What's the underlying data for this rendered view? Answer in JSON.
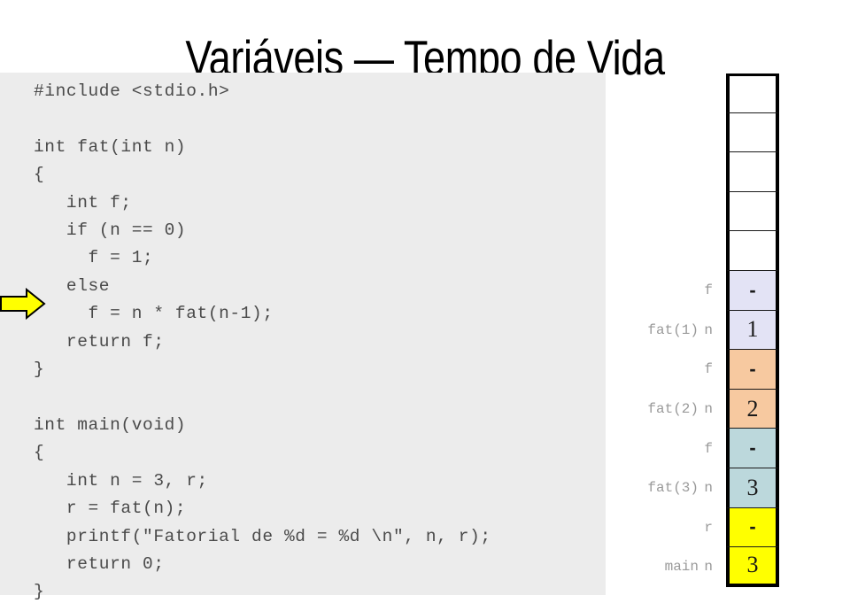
{
  "slide": {
    "title": "Variáveis — Tempo de Vida",
    "background_color": "#ffffff"
  },
  "code_panel": {
    "background_color": "#ececec",
    "text_color": "#4a4a4a",
    "language": "c",
    "listing": "#include <stdio.h>\n\nint fat(int n)\n{\n   int f;\n   if (n == 0)\n     f = 1;\n   else\n     f = n * fat(n-1);\n   return f;\n}\n\nint main(void)\n{\n   int n = 3, r;\n   r = fat(n);\n   printf(\"Fatorial de %d = %d \\n\", n, r);\n   return 0;\n}",
    "lines": [
      "#include <stdio.h>",
      "",
      "int fat(int n)",
      "{",
      "   int f;",
      "   if (n == 0)",
      "     f = 1;",
      "   else",
      "     f = n * fat(n-1);",
      "   return f;",
      "}",
      "",
      "int main(void)",
      "{",
      "   int n = 3, r;",
      "   r = fat(n);",
      "   printf(\"Fatorial de %d = %d \\n\", n, r);",
      "   return 0;",
      "}"
    ]
  },
  "step_arrow": {
    "icon": "arrow-right-icon",
    "fill_color": "#ffff00",
    "outline_color": "#000000",
    "points_to_line": "f = n * fat(n-1);",
    "points_to_line_index": 8
  },
  "stack_diagram": {
    "label_color": "#9a9a9a",
    "border_color": "#000000",
    "rows": [
      {
        "frame": "",
        "var": "",
        "value": "",
        "fill": "#ffffff"
      },
      {
        "frame": "",
        "var": "",
        "value": "",
        "fill": "#ffffff"
      },
      {
        "frame": "",
        "var": "",
        "value": "",
        "fill": "#ffffff"
      },
      {
        "frame": "",
        "var": "",
        "value": "",
        "fill": "#ffffff"
      },
      {
        "frame": "",
        "var": "",
        "value": "",
        "fill": "#ffffff"
      },
      {
        "frame": "",
        "var": "f",
        "value": "-",
        "fill": "#e3e3f5"
      },
      {
        "frame": "fat(1)",
        "var": "n",
        "value": "1",
        "fill": "#e3e3f5"
      },
      {
        "frame": "",
        "var": "f",
        "value": "-",
        "fill": "#f7c9a0"
      },
      {
        "frame": "fat(2)",
        "var": "n",
        "value": "2",
        "fill": "#f7c9a0"
      },
      {
        "frame": "",
        "var": "f",
        "value": "-",
        "fill": "#bcd8dc"
      },
      {
        "frame": "fat(3)",
        "var": "n",
        "value": "3",
        "fill": "#bcd8dc"
      },
      {
        "frame": "",
        "var": "r",
        "value": "-",
        "fill": "#ffff00"
      },
      {
        "frame": "main",
        "var": "n",
        "value": "3",
        "fill": "#ffff00"
      }
    ]
  }
}
